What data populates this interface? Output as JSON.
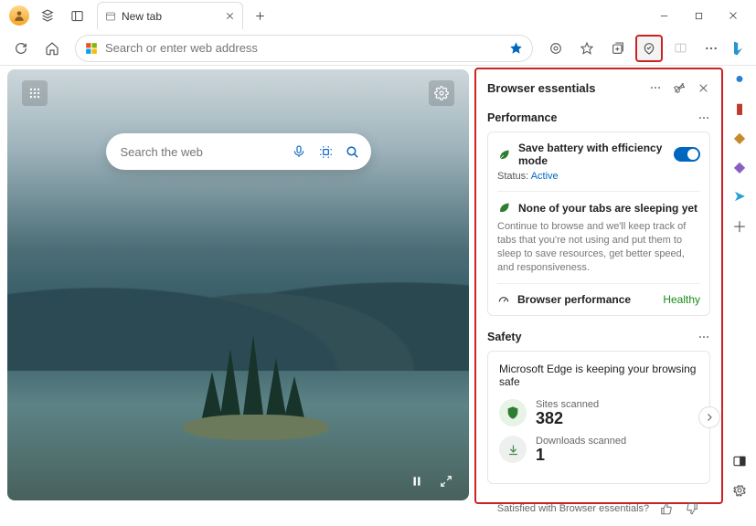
{
  "tab": {
    "title": "New tab"
  },
  "addr": {
    "placeholder": "Search or enter web address"
  },
  "search": {
    "placeholder": "Search the web"
  },
  "panel": {
    "title": "Browser essentials",
    "performance": {
      "title": "Performance",
      "efficiency_label": "Save battery with efficiency mode",
      "status_label": "Status:",
      "status_value": "Active",
      "sleep_title": "None of your tabs are sleeping yet",
      "sleep_body": "Continue to browse and we'll keep track of tabs that you're not using and put them to sleep to save resources, get better speed, and responsiveness.",
      "perf_label": "Browser performance",
      "perf_value": "Healthy"
    },
    "safety": {
      "title": "Safety",
      "headline": "Microsoft Edge is keeping your browsing safe",
      "sites_label": "Sites scanned",
      "sites_value": "382",
      "downloads_label": "Downloads scanned",
      "downloads_value": "1"
    },
    "feedback": "Satisfied with Browser essentials?"
  }
}
